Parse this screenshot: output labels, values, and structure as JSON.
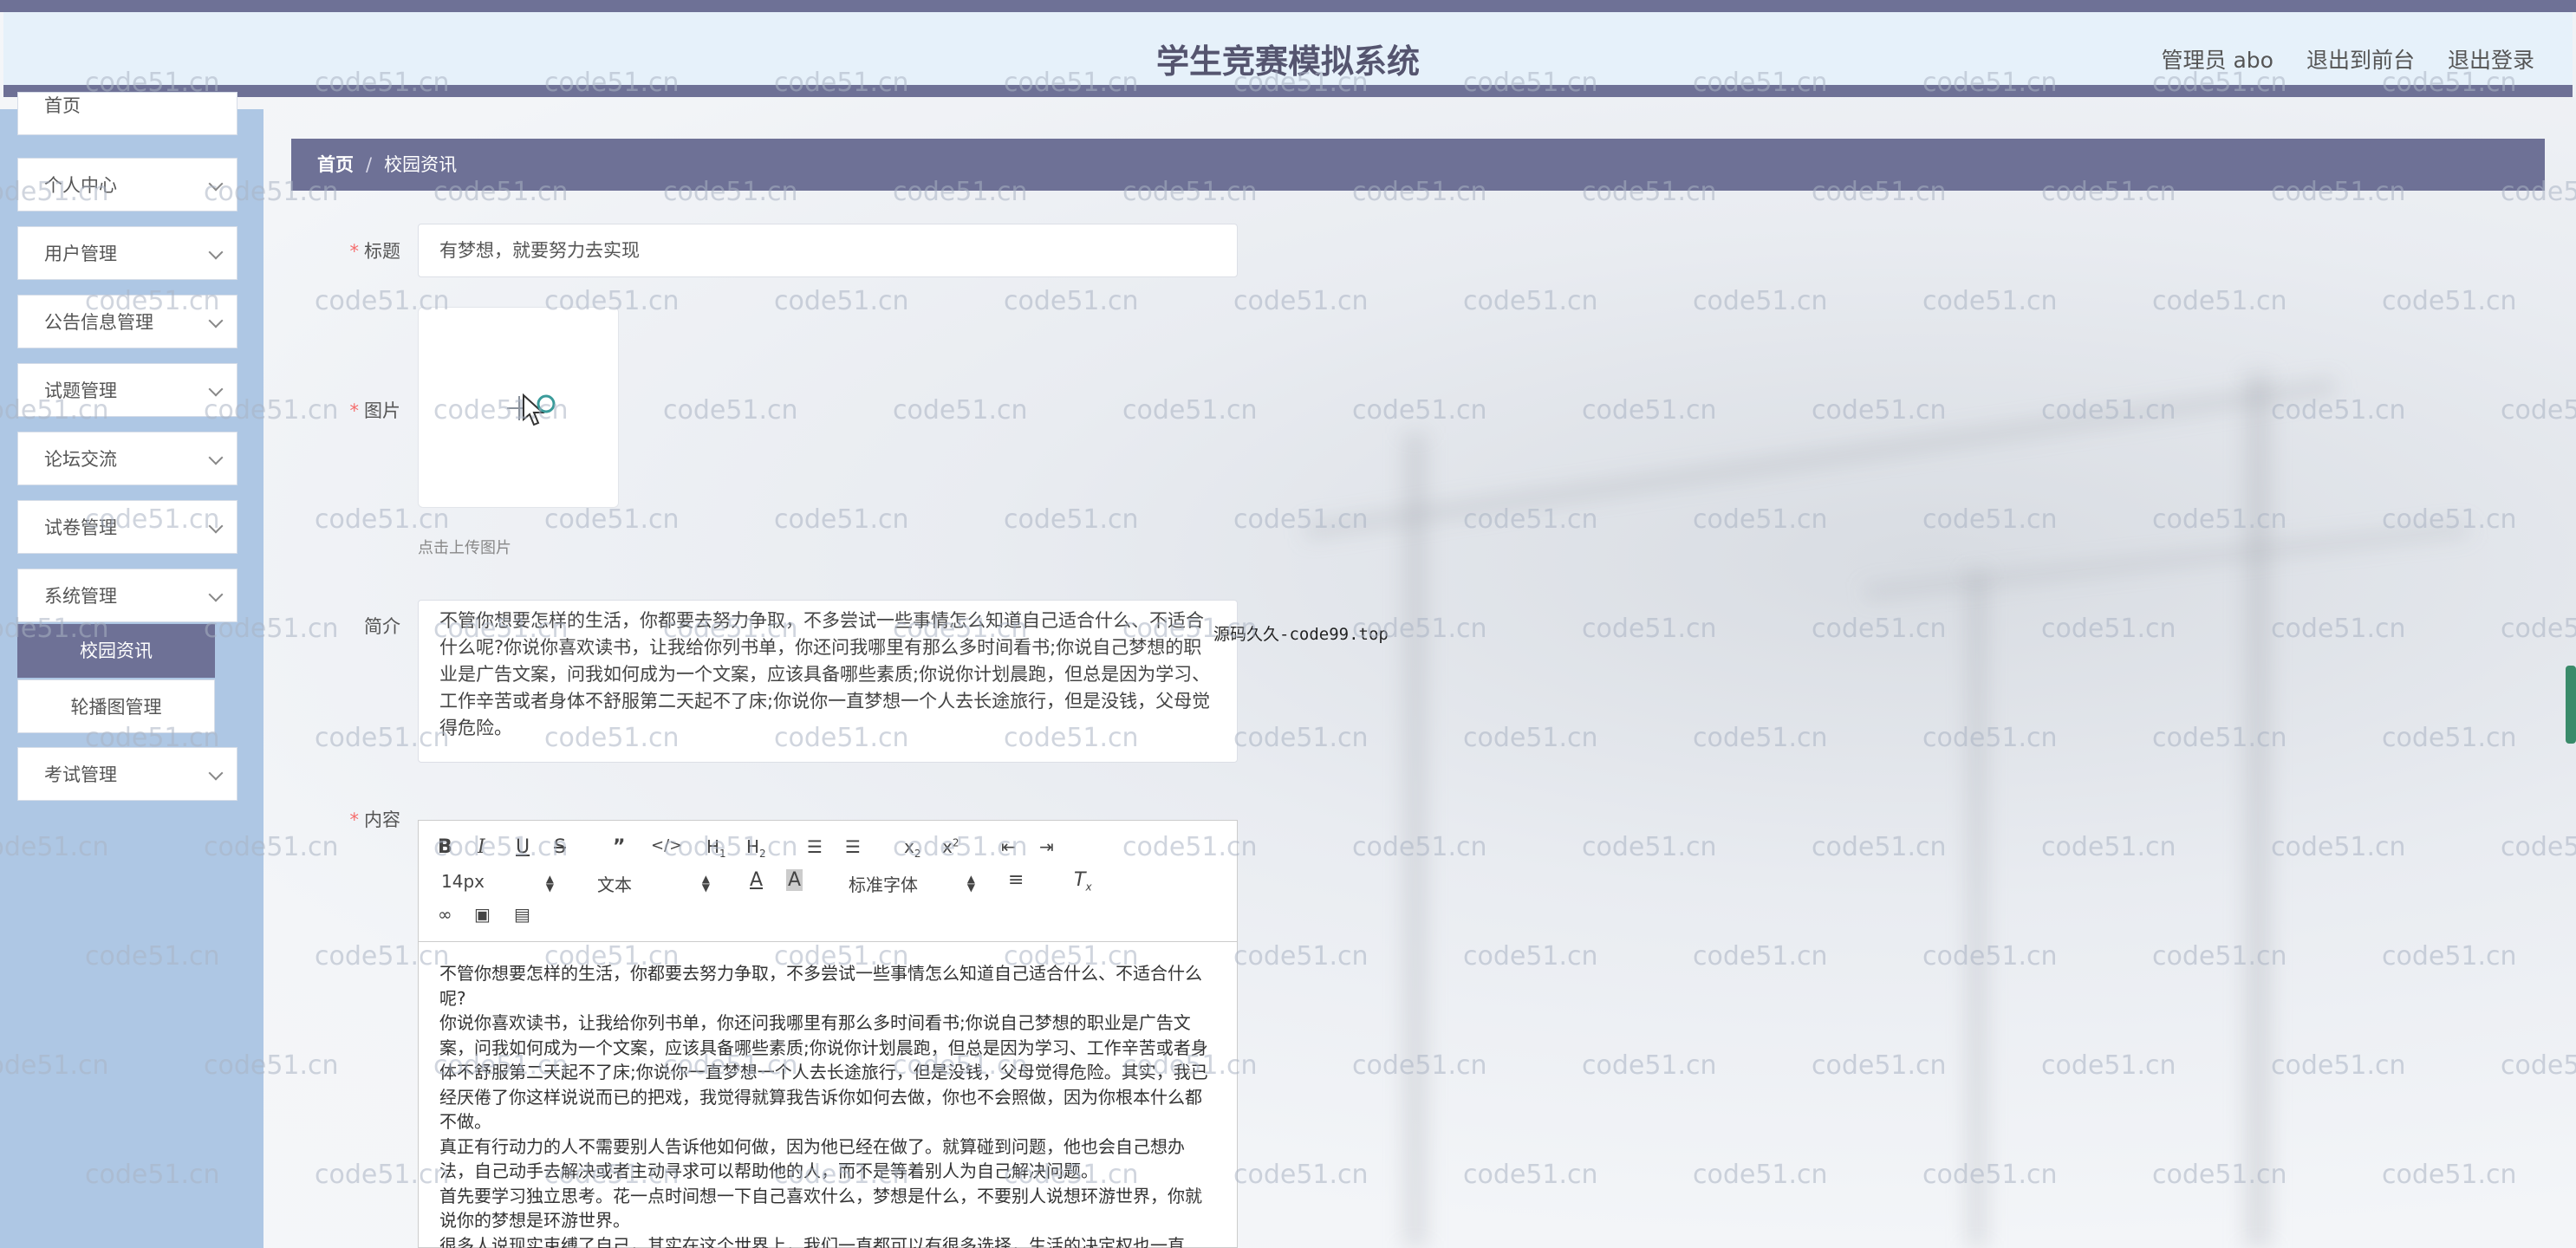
{
  "header": {
    "title": "学生竞赛模拟系统",
    "admin_label": "管理员 abo",
    "to_front": "退出到前台",
    "logout": "退出登录"
  },
  "sidebar": {
    "items": [
      {
        "label": "首页"
      },
      {
        "label": "个人中心"
      },
      {
        "label": "用户管理"
      },
      {
        "label": "公告信息管理"
      },
      {
        "label": "试题管理"
      },
      {
        "label": "论坛交流"
      },
      {
        "label": "试卷管理"
      },
      {
        "label": "系统管理"
      },
      {
        "label": "考试管理"
      }
    ],
    "sub_items": [
      {
        "label": "校园资讯",
        "active": true
      },
      {
        "label": "轮播图管理",
        "active": false
      }
    ]
  },
  "breadcrumb": {
    "home": "首页",
    "separator": "/",
    "current": "校园资讯"
  },
  "form": {
    "title_label": "标题",
    "title_value": "有梦想，就要努力去实现",
    "image_label": "图片",
    "upload_tip": "点击上传图片",
    "intro_label": "简介",
    "intro_value": "不管你想要怎样的生活，你都要去努力争取，不多尝试一些事情怎么知道自己适合什么、不适合什么呢?你说你喜欢读书，让我给你列书单，你还问我哪里有那么多时间看书;你说自己梦想的职业是广告文案，问我如何成为一个文案，应该具备哪些素质;你说你计划晨跑，但总是因为学习、工作辛苦或者身体不舒服第二天起不了床;你说你一直梦想一个人去长途旅行，但是没钱，父母觉得危险。",
    "content_label": "内容",
    "required_mark": "*"
  },
  "side_note": "源码久久-code99.top",
  "editor": {
    "font_size": "14px",
    "block_type": "文本",
    "font_family": "标准字体",
    "paragraphs": [
      "不管你想要怎样的生活，你都要去努力争取，不多尝试一些事情怎么知道自己适合什么、不适合什么呢?",
      "你说你喜欢读书，让我给你列书单，你还问我哪里有那么多时间看书;你说自己梦想的职业是广告文案，问我如何成为一个文案，应该具备哪些素质;你说你计划晨跑，但总是因为学习、工作辛苦或者身体不舒服第二天起不了床;你说你一直梦想一个人去长途旅行，但是没钱，父母觉得危险。其实，我已经厌倦了你这样说说而已的把戏，我觉得就算我告诉你如何去做，你也不会照做，因为你根本什么都不做。",
      "真正有行动力的人不需要别人告诉他如何做，因为他已经在做了。就算碰到问题，他也会自己想办法，自己动手去解决或者主动寻求可以帮助他的人，而不是等着别人为自己解决问题。",
      "首先要学习独立思考。花一点时间想一下自己喜欢什么，梦想是什么，不要别人说想环游世界，你就说你的梦想是环游世界。",
      "很多人说现实束缚了自己，其实在这个世界上，我们一直都可以有很多选择，生活的决定权也一直"
    ]
  },
  "watermark": "code51.cn",
  "colors": {
    "accent": "#6e7196",
    "sidebar_bg": "#aec7e4",
    "header_bg": "#e6f1fa",
    "required": "#f56c6c"
  }
}
